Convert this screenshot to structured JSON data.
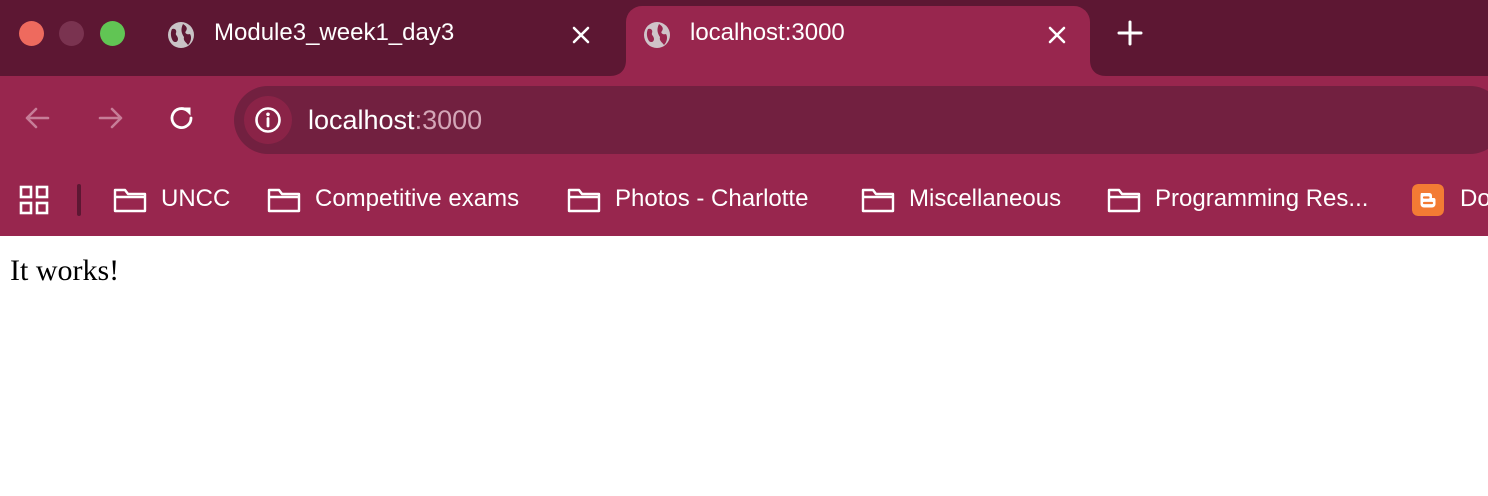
{
  "colors": {
    "frame": "#5d1733",
    "toolbar": "#98264e",
    "omnibox": "#722040",
    "site_info_bg": "#8a2347",
    "traffic_red": "#ee6a5e",
    "traffic_gray": "#7a3350",
    "traffic_green": "#61c554",
    "separator": "#5d1733",
    "url_host": "#ffffff",
    "url_port": "#d4a6b7",
    "icon_active": "#ffffff",
    "icon_dim": "#c77d98",
    "blogger": "#f37b34"
  },
  "tabs": [
    {
      "title": "Module3_week1_day3",
      "icon": "globe-icon",
      "active": false
    },
    {
      "title": "localhost:3000",
      "icon": "globe-icon",
      "active": true
    }
  ],
  "toolbar": {
    "url_host": "localhost",
    "url_port": ":3000"
  },
  "bookmarks": [
    {
      "label": "UNCC",
      "icon": "folder-icon"
    },
    {
      "label": "Competitive exams",
      "icon": "folder-icon"
    },
    {
      "label": "Photos - Charlotte",
      "icon": "folder-icon"
    },
    {
      "label": "Miscellaneous",
      "icon": "folder-icon"
    },
    {
      "label": "Programming Res...",
      "icon": "folder-icon"
    },
    {
      "label": "Do",
      "icon": "blogger-icon"
    }
  ],
  "page": {
    "body_text": "It works!"
  }
}
